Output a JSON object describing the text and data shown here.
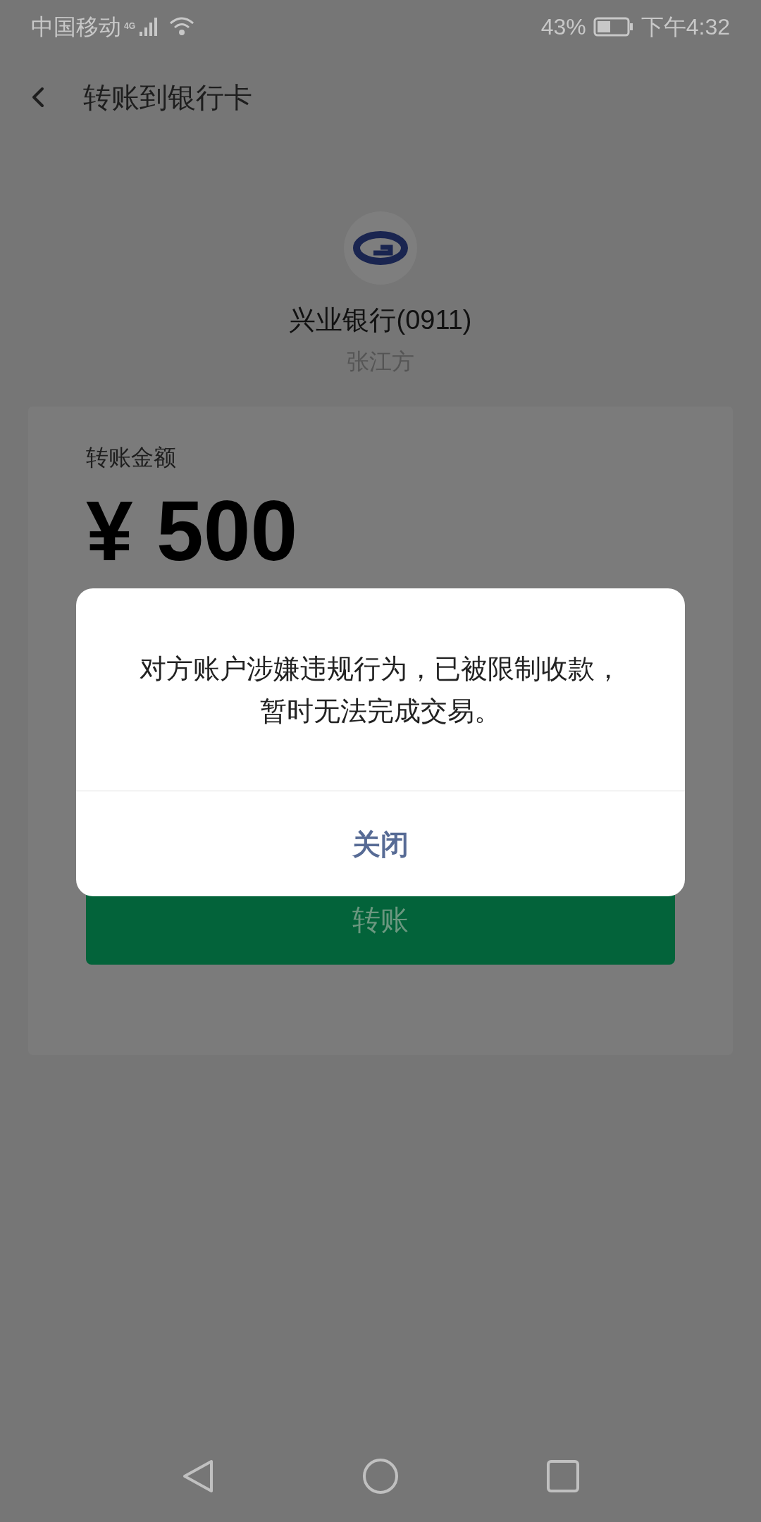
{
  "status_bar": {
    "carrier": "中国移动",
    "network": "4G",
    "battery": "43%",
    "time": "下午4:32"
  },
  "header": {
    "title": "转账到银行卡"
  },
  "payee": {
    "bank": "兴业银行(0911)",
    "name": "张江方"
  },
  "amount_card": {
    "label": "转账金额",
    "amount": "¥ 500",
    "button": "转账"
  },
  "dialog": {
    "message": "对方账户涉嫌违规行为，已被限制收款，暂时无法完成交易。",
    "button": "关闭"
  }
}
